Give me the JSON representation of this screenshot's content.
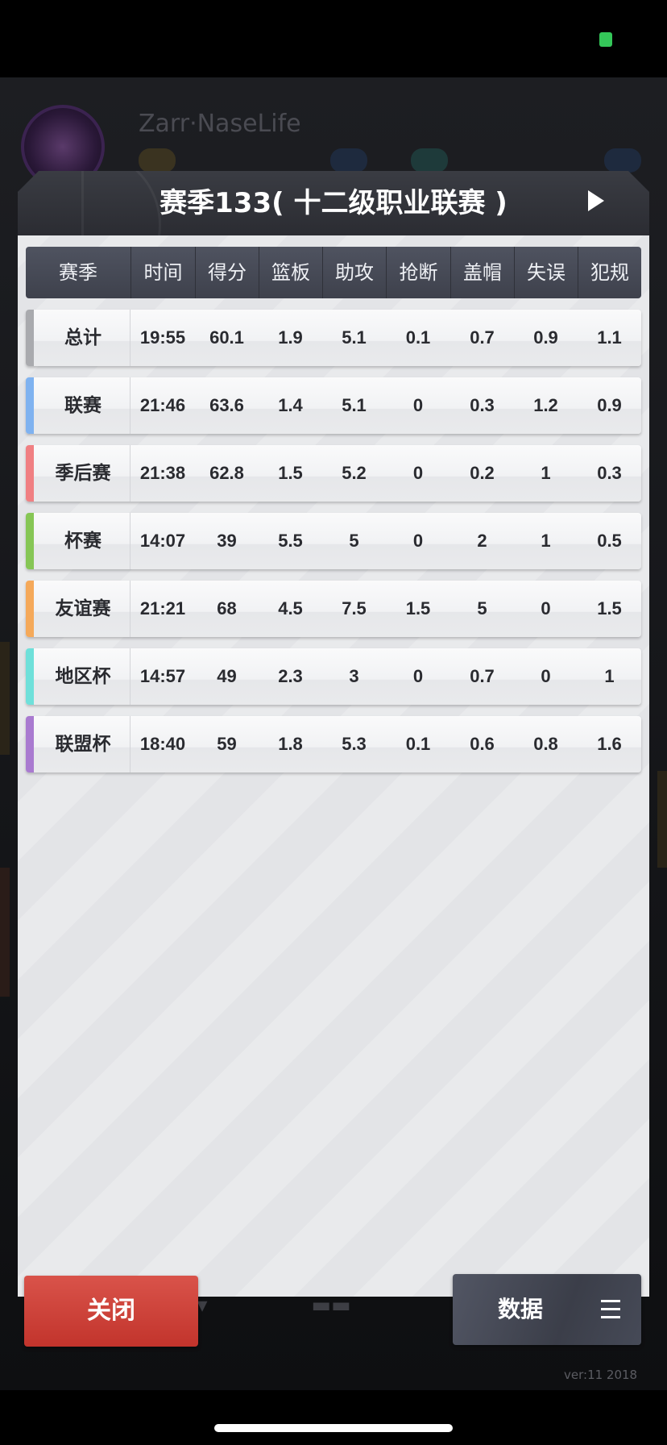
{
  "modal": {
    "title": "赛季133( 十二级职业联赛 )",
    "close_label": "关闭",
    "data_label": "数据"
  },
  "table": {
    "headers": [
      "赛季",
      "时间",
      "得分",
      "篮板",
      "助攻",
      "抢断",
      "盖帽",
      "失误",
      "犯规"
    ],
    "rows": [
      {
        "cells": [
          "总计",
          "19:55",
          "60.1",
          "1.9",
          "5.1",
          "0.1",
          "0.7",
          "0.9",
          "1.1"
        ],
        "accent": "#a9aaae"
      },
      {
        "cells": [
          "联赛",
          "21:46",
          "63.6",
          "1.4",
          "5.1",
          "0",
          "0.3",
          "1.2",
          "0.9"
        ],
        "accent": "#7fb2f0"
      },
      {
        "cells": [
          "季后赛",
          "21:38",
          "62.8",
          "1.5",
          "5.2",
          "0",
          "0.2",
          "1",
          "0.3"
        ],
        "accent": "#f07f82"
      },
      {
        "cells": [
          "杯赛",
          "14:07",
          "39",
          "5.5",
          "5",
          "0",
          "2",
          "1",
          "0.5"
        ],
        "accent": "#86c655"
      },
      {
        "cells": [
          "友谊赛",
          "21:21",
          "68",
          "4.5",
          "7.5",
          "1.5",
          "5",
          "0",
          "1.5"
        ],
        "accent": "#f5a95a"
      },
      {
        "cells": [
          "地区杯",
          "14:57",
          "49",
          "2.3",
          "3",
          "0",
          "0.7",
          "0",
          "1"
        ],
        "accent": "#6fe0da"
      },
      {
        "cells": [
          "联盟杯",
          "18:40",
          "59",
          "1.8",
          "5.3",
          "0.1",
          "0.6",
          "0.8",
          "1.6"
        ],
        "accent": "#a97ad0"
      }
    ]
  },
  "footer": {
    "version": "ver:11  2018"
  },
  "icons": {
    "next": "play-arrow-icon",
    "menu": "menu-lines-icon"
  }
}
